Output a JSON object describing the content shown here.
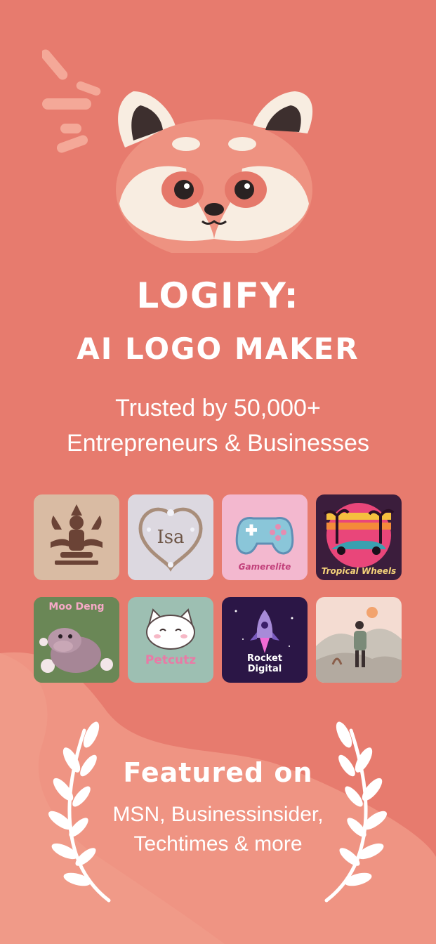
{
  "hero": {
    "title_line1": "LOGIFY:",
    "title_line2": "AI LOGO MAKER",
    "subtitle_line1": "Trusted by 50,000+",
    "subtitle_line2": "Entrepreneurs & Businesses"
  },
  "gallery": {
    "items": [
      {
        "label": "",
        "icon": "deity-logo-icon"
      },
      {
        "label": "Isa",
        "icon": "ornate-frame-icon"
      },
      {
        "label": "Gamerelite",
        "icon": "game-controller-icon"
      },
      {
        "label": "Tropical Wheels",
        "icon": "car-sunset-icon"
      },
      {
        "label": "Moo Deng",
        "icon": "hippo-icon"
      },
      {
        "label": "Petcutz",
        "icon": "cat-icon"
      },
      {
        "label": "Rocket Digital",
        "icon": "rocket-icon"
      },
      {
        "label": "",
        "icon": "hiker-icon"
      }
    ]
  },
  "featured": {
    "heading": "Featured on",
    "line1": "MSN, Businessinsider,",
    "line2": "Techtimes & more"
  },
  "colors": {
    "background": "#e77b6e",
    "wave": "#ef9483",
    "text": "#ffffff"
  }
}
